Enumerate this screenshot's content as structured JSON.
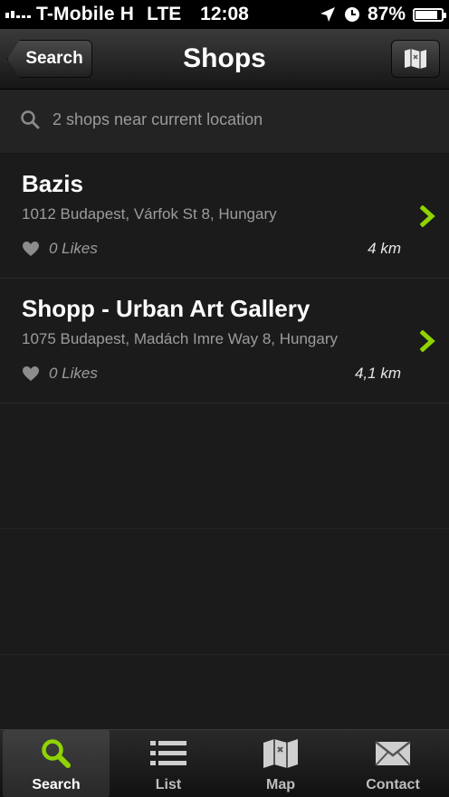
{
  "status_bar": {
    "carrier": "T-Mobile H",
    "network": "LTE",
    "time": "12:08",
    "battery": "87%",
    "battery_level": 0.87
  },
  "nav": {
    "back_label": "Search",
    "title": "Shops",
    "map_icon": "map-icon"
  },
  "search": {
    "summary": "2 shops near current location"
  },
  "shops": [
    {
      "name": "Bazis",
      "address": "1012 Budapest, Várfok St 8, Hungary",
      "likes": "0 Likes",
      "distance": "4 km"
    },
    {
      "name": "Shopp - Urban Art Gallery",
      "address": "1075 Budapest, Madách Imre Way 8, Hungary",
      "likes": "0 Likes",
      "distance": "4,1 km"
    }
  ],
  "tabs": [
    {
      "label": "Search",
      "icon": "search-icon",
      "active": true
    },
    {
      "label": "List",
      "icon": "list-icon",
      "active": false
    },
    {
      "label": "Map",
      "icon": "map-icon",
      "active": false
    },
    {
      "label": "Contact",
      "icon": "envelope-icon",
      "active": false
    }
  ],
  "colors": {
    "accent": "#8fd400",
    "background": "#1b1b1b",
    "secondary_text": "#9c9c9c"
  }
}
